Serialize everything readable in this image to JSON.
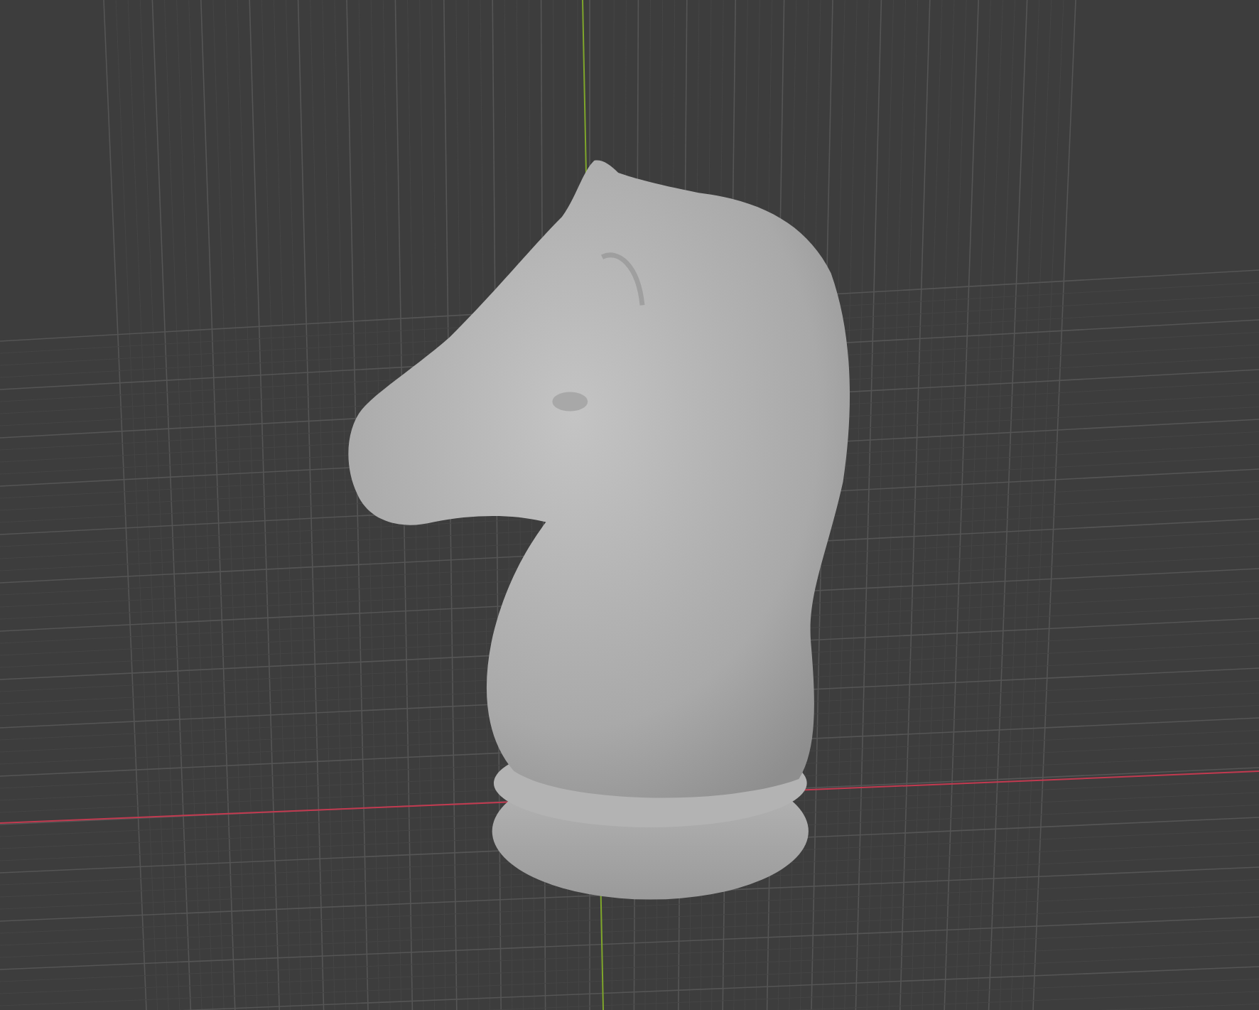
{
  "viewport": {
    "show_grid": true,
    "show_x_axis": true,
    "show_y_axis": true
  }
}
